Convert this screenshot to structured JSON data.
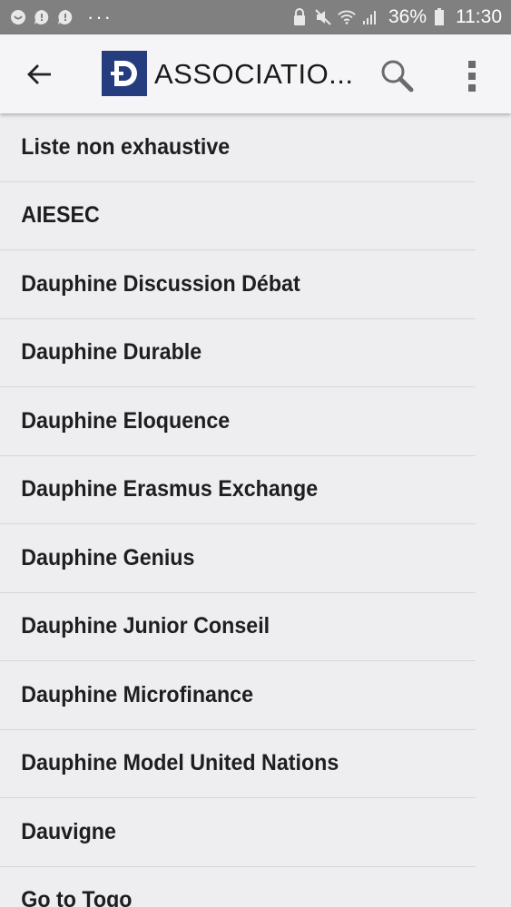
{
  "status_bar": {
    "icons_left": [
      "messenger-icon",
      "chat-icon",
      "chat-icon"
    ],
    "overflow": "···",
    "icons_right": [
      "lock-icon",
      "mute-icon",
      "wifi-icon",
      "signal-icon"
    ],
    "battery": "36%",
    "time": "11:30"
  },
  "app_bar": {
    "title": "ASSOCIATIO...",
    "logo_letter": "D",
    "logo_color": "#253d7e"
  },
  "list": {
    "items": [
      "Liste non exhaustive",
      "AIESEC",
      "Dauphine Discussion Débat",
      "Dauphine Durable",
      "Dauphine Eloquence",
      "Dauphine Erasmus Exchange",
      "Dauphine Genius",
      "Dauphine Junior Conseil",
      "Dauphine Microfinance",
      "Dauphine Model United Nations",
      "Dauvigne",
      "Go to Togo"
    ]
  }
}
